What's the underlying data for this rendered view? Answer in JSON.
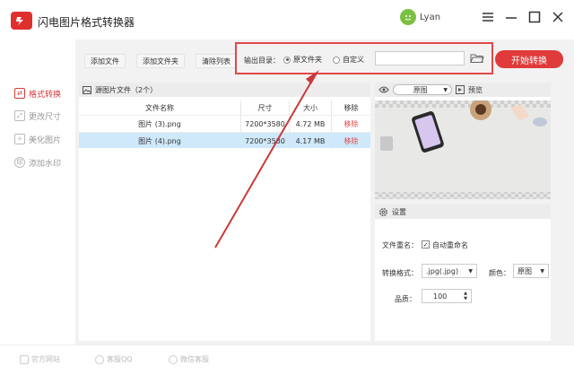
{
  "app": {
    "title": "闪电图片格式转换器",
    "user": "Lyan"
  },
  "colors": {
    "accent": "#e03a3a",
    "selected_row": "#cfe8fa"
  },
  "sidebar": {
    "items": [
      {
        "label": "格式转换",
        "active": true,
        "icon": "convert-icon"
      },
      {
        "label": "更改尺寸",
        "active": false,
        "icon": "resize-icon"
      },
      {
        "label": "美化图片",
        "active": false,
        "icon": "beautify-icon"
      },
      {
        "label": "添加水印",
        "active": false,
        "icon": "watermark-icon"
      }
    ]
  },
  "toolbar": {
    "add_file": "添加文件",
    "add_folder": "添加文件夹",
    "clear_list": "清除列表",
    "output_label": "输出目录：",
    "radio_original": "原文件夹",
    "radio_custom": "自定义",
    "output_selected": "原文件夹",
    "path_value": "",
    "start": "开始转换"
  },
  "file_list": {
    "header": "源图片文件（2个）",
    "columns": [
      "文件名称",
      "尺寸",
      "大小",
      "移除"
    ],
    "rows": [
      {
        "name": "图片 (3).png",
        "dims": "7200*3580",
        "size": "4.72 MB",
        "remove": "移除",
        "selected": false
      },
      {
        "name": "图片 (4).png",
        "dims": "7200*3580",
        "size": "4.17 MB",
        "remove": "移除",
        "selected": true
      }
    ]
  },
  "preview": {
    "mode": "原图",
    "label": "预览"
  },
  "settings": {
    "title": "设置",
    "rename_label": "文件重名：",
    "auto_rename": "自动重命名",
    "auto_rename_checked": true,
    "format_label": "转换格式：",
    "format_value": ".jpg(.jpg)",
    "color_label": "颜色：",
    "color_value": "原图",
    "quality_label": "品质：",
    "quality_value": "100"
  },
  "footer": {
    "website": "官方网站",
    "qq": "客服QQ",
    "wechat": "微信客服"
  }
}
